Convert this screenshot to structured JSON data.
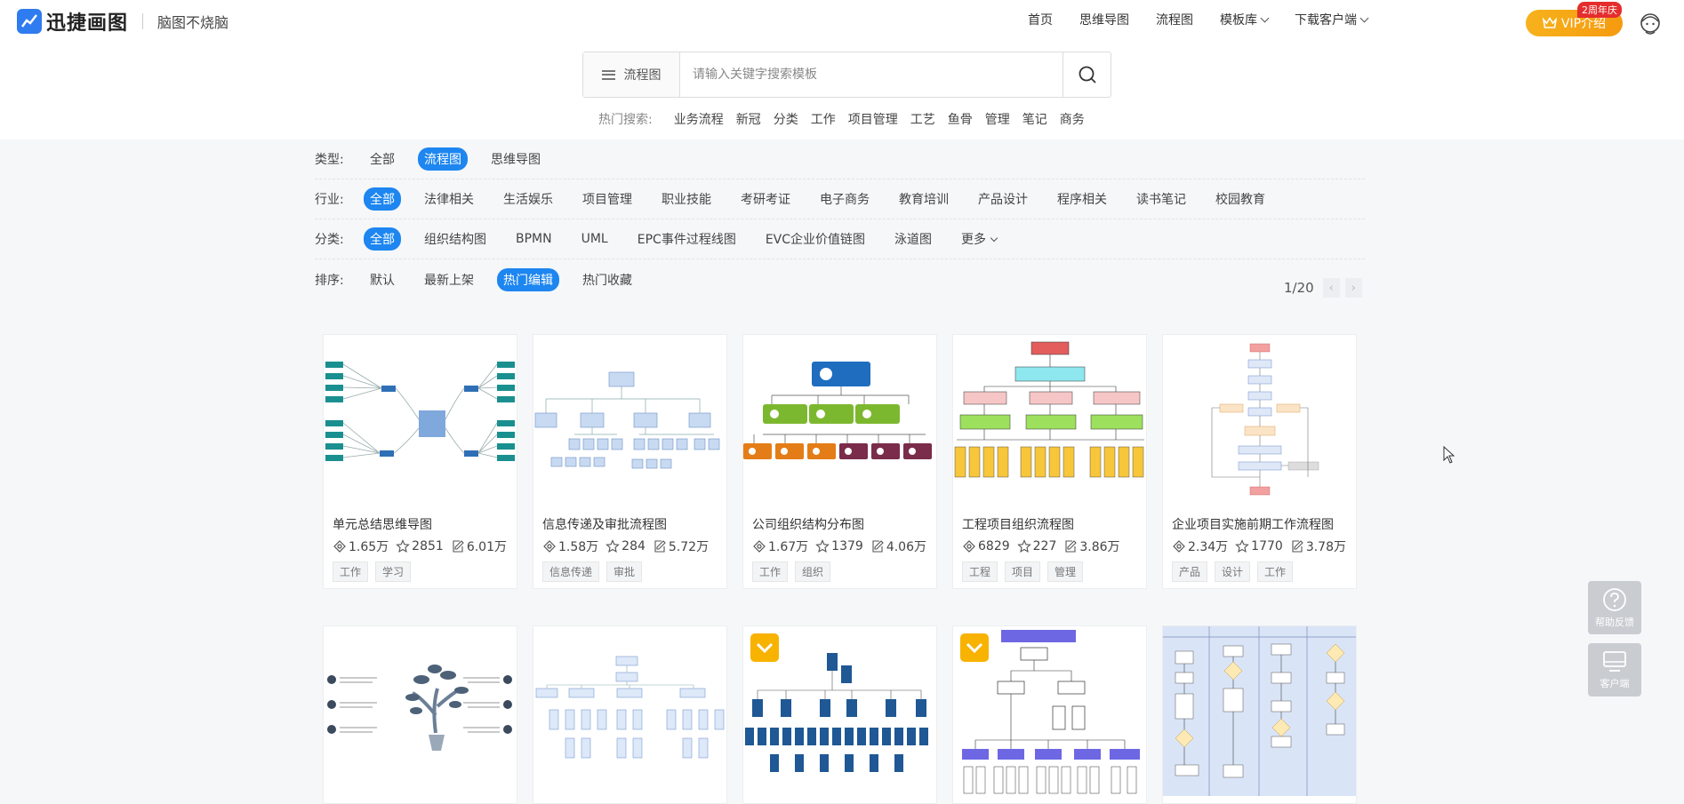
{
  "header": {
    "logo_text": "迅捷画图",
    "slogan": "脑图不烧脑",
    "nav": [
      {
        "label": "首页",
        "dropdown": false
      },
      {
        "label": "思维导图",
        "dropdown": false
      },
      {
        "label": "流程图",
        "dropdown": false
      },
      {
        "label": "模板库",
        "dropdown": true
      },
      {
        "label": "下载客户端",
        "dropdown": true
      }
    ],
    "vip_label": "VIP介绍",
    "vip_badge": "2周年庆"
  },
  "search": {
    "type_label": "流程图",
    "placeholder": "请输入关键字搜索模板"
  },
  "hot_search": {
    "label": "热门搜索:",
    "items": [
      "业务流程",
      "新冠",
      "分类",
      "工作",
      "项目管理",
      "工艺",
      "鱼骨",
      "管理",
      "笔记",
      "商务"
    ]
  },
  "filters": [
    {
      "label": "类型:",
      "options": [
        "全部",
        "流程图",
        "思维导图"
      ],
      "active": 1
    },
    {
      "label": "行业:",
      "options": [
        "全部",
        "法律相关",
        "生活娱乐",
        "项目管理",
        "职业技能",
        "考研考证",
        "电子商务",
        "教育培训",
        "产品设计",
        "程序相关",
        "读书笔记",
        "校园教育"
      ],
      "active": 0
    },
    {
      "label": "分类:",
      "options": [
        "全部",
        "组织结构图",
        "BPMN",
        "UML",
        "EPC事件过程线图",
        "EVC企业价值链图",
        "泳道图",
        "更多"
      ],
      "active": 0
    },
    {
      "label": "排序:",
      "options": [
        "默认",
        "最新上架",
        "热门编辑",
        "热门收藏"
      ],
      "active": 2
    }
  ],
  "pagination": {
    "text": "1/20",
    "prev": "‹",
    "next": "›"
  },
  "cards": [
    {
      "title": "单元总结思维导图",
      "views": "1.65万",
      "stars": "2851",
      "edits": "6.01万",
      "tags": [
        "工作",
        "学习"
      ]
    },
    {
      "title": "信息传递及审批流程图",
      "views": "1.58万",
      "stars": "284",
      "edits": "5.72万",
      "tags": [
        "信息传递",
        "审批"
      ]
    },
    {
      "title": "公司组织结构分布图",
      "views": "1.67万",
      "stars": "1379",
      "edits": "4.06万",
      "tags": [
        "工作",
        "组织"
      ]
    },
    {
      "title": "工程项目组织流程图",
      "views": "6829",
      "stars": "227",
      "edits": "3.86万",
      "tags": [
        "工程",
        "项目",
        "管理"
      ]
    },
    {
      "title": "企业项目实施前期工作流程图",
      "views": "2.34万",
      "stars": "1770",
      "edits": "3.78万",
      "tags": [
        "产品",
        "设计",
        "工作"
      ]
    }
  ],
  "side": {
    "help": "帮助反馈",
    "client": "客户端"
  },
  "colors": {
    "accent": "#1d86f0",
    "vip": "#f7a51a",
    "badge": "#e52d2d"
  }
}
